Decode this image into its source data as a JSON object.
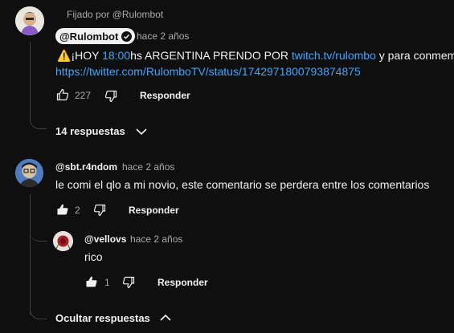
{
  "pinned": {
    "label": "Fijado por @Rulombot",
    "author": "@Rulombot",
    "time": "hace 2 años",
    "text_warning": "⚠️",
    "text_before_time": "¡HOY ",
    "time_link": "18:00",
    "text_mid": "hs ARGENTINA PRENDO POR ",
    "twitch_link": "twitch.tv/rulombo",
    "text_after": " y para conmemo",
    "twitter_link": "https://twitter.com/RulomboTV/status/1742971800793874875",
    "likes": "227",
    "reply_label": "Responder",
    "replies_toggle": "14 respuestas"
  },
  "reply1": {
    "author": "@sbt.r4ndom",
    "time": "hace 2 años",
    "text": "le comi el qlo a mi novio, este comentario se perdera entre los comentarios",
    "likes": "2",
    "reply_label": "Responder"
  },
  "reply2": {
    "author": "@vellovs",
    "time": "hace 2 años",
    "text": "rico",
    "likes": "1",
    "reply_label": "Responder"
  },
  "hide_replies": "Ocultar respuestas"
}
